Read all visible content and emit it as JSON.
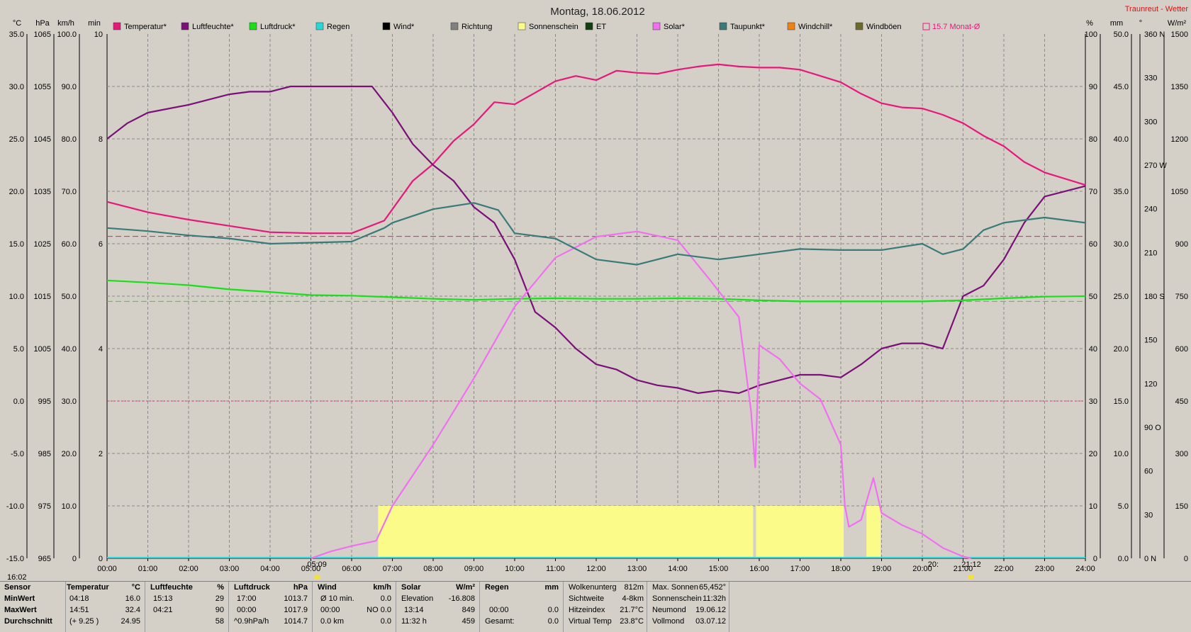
{
  "title": "Montag, 18.06.2012",
  "site": "Traunreut - Wetter",
  "corner_time": "16:02",
  "legend": [
    {
      "label": "Temperatur*",
      "color": "#e8177a"
    },
    {
      "label": "Luftfeuchte*",
      "color": "#7a1078"
    },
    {
      "label": "Luftdruck*",
      "color": "#18e018"
    },
    {
      "label": "Regen",
      "color": "#28d8d8"
    },
    {
      "label": "Wind*",
      "color": "#000000"
    },
    {
      "label": "Richtung",
      "color": "#808080"
    },
    {
      "label": "Sonnenschein",
      "color": "#fbfb8a"
    },
    {
      "label": "ET",
      "color": "#104010"
    },
    {
      "label": "Solar*",
      "color": "#f070f0"
    },
    {
      "label": "Taupunkt*",
      "color": "#3a7a78"
    },
    {
      "label": "Windchill*",
      "color": "#f08010"
    },
    {
      "label": "Windböen",
      "color": "#6a6a2a"
    }
  ],
  "month_avg": "15.7 Monat-Ø",
  "axis_units": {
    "temp": "°C",
    "press": "hPa",
    "wind": "km/h",
    "min": "min",
    "pct": "%",
    "mm": "mm",
    "deg": "°",
    "wm2": "W/m²"
  },
  "axes": {
    "temp": [
      "35.0",
      "30.0",
      "25.0",
      "20.0",
      "15.0",
      "10.0",
      "5.0",
      "0.0",
      "-5.0",
      "-10.0",
      "-15.0"
    ],
    "press": [
      "1065",
      "1055",
      "1045",
      "1035",
      "1025",
      "1015",
      "1005",
      "995",
      "985",
      "975",
      "965"
    ],
    "wind": [
      "100.0",
      "90.0",
      "80.0",
      "70.0",
      "60.0",
      "50.0",
      "40.0",
      "30.0",
      "20.0",
      "10.0",
      "0"
    ],
    "min": [
      "10",
      "",
      "8",
      "",
      "6",
      "",
      "4",
      "",
      "2",
      "",
      "0"
    ],
    "pct": [
      "100",
      "90",
      "80",
      "70",
      "60",
      "50",
      "40",
      "30",
      "20",
      "10",
      "0"
    ],
    "mm": [
      "50.0",
      "45.0",
      "40.0",
      "35.0",
      "30.0",
      "25.0",
      "20.0",
      "15.0",
      "10.0",
      "5.0",
      "0.0"
    ],
    "deg": [
      "360 N",
      "330",
      "300",
      "270 W",
      "240",
      "210",
      "180 S",
      "150",
      "120",
      "90  O",
      "60",
      "30",
      "0  N"
    ],
    "wm2": [
      "1500",
      "1350",
      "1200",
      "1050",
      "900",
      "750",
      "600",
      "450",
      "300",
      "150",
      "0"
    ],
    "x": [
      "00:00",
      "01:00",
      "02:00",
      "03:00",
      "04:00",
      "05:00",
      "06:00",
      "07:00",
      "08:00",
      "09:00",
      "10:00",
      "11:00",
      "12:00",
      "13:00",
      "14:00",
      "15:00",
      "16:00",
      "17:00",
      "18:00",
      "19:00",
      "20:00",
      "21:00",
      "22:00",
      "23:00",
      "24:00"
    ]
  },
  "sun_markers": {
    "sunrise": "05:09",
    "sunset_a": "20:",
    "sunset_b": "21:12"
  },
  "chart_data": {
    "type": "line",
    "title": "Montag, 18.06.2012",
    "x_unit": "hours",
    "series": [
      {
        "name": "Temperatur*",
        "unit": "°C",
        "color": "#e8177a",
        "points": [
          [
            0,
            19
          ],
          [
            1,
            18
          ],
          [
            2,
            17.3
          ],
          [
            3,
            16.7
          ],
          [
            4,
            16.1
          ],
          [
            5,
            16.0
          ],
          [
            6,
            16.0
          ],
          [
            6.8,
            17.2
          ],
          [
            7.5,
            21
          ],
          [
            8,
            22.6
          ],
          [
            8.5,
            24.8
          ],
          [
            9,
            26.4
          ],
          [
            9.5,
            28.5
          ],
          [
            10,
            28.3
          ],
          [
            10.5,
            29.4
          ],
          [
            11,
            30.5
          ],
          [
            11.5,
            31.0
          ],
          [
            12,
            30.6
          ],
          [
            12.5,
            31.5
          ],
          [
            13,
            31.3
          ],
          [
            13.5,
            31.2
          ],
          [
            14,
            31.6
          ],
          [
            14.5,
            31.9
          ],
          [
            15,
            32.1
          ],
          [
            15.5,
            31.9
          ],
          [
            16,
            31.8
          ],
          [
            16.5,
            31.8
          ],
          [
            17,
            31.6
          ],
          [
            17.5,
            31.0
          ],
          [
            18,
            30.4
          ],
          [
            18.5,
            29.3
          ],
          [
            19,
            28.4
          ],
          [
            19.5,
            28.0
          ],
          [
            20,
            27.9
          ],
          [
            20.5,
            27.3
          ],
          [
            21,
            26.5
          ],
          [
            21.5,
            25.3
          ],
          [
            22,
            24.3
          ],
          [
            22.5,
            22.8
          ],
          [
            23,
            21.8
          ],
          [
            24,
            20.6
          ]
        ]
      },
      {
        "name": "Luftfeuchte*",
        "unit": "%",
        "color": "#7a1078",
        "points": [
          [
            0,
            80
          ],
          [
            0.5,
            83
          ],
          [
            1,
            85
          ],
          [
            2,
            86.5
          ],
          [
            3,
            88.5
          ],
          [
            3.5,
            89
          ],
          [
            4,
            89
          ],
          [
            4.5,
            90
          ],
          [
            5,
            90
          ],
          [
            6,
            90
          ],
          [
            6.5,
            90
          ],
          [
            6.8,
            87
          ],
          [
            7,
            85
          ],
          [
            7.5,
            79
          ],
          [
            8,
            75
          ],
          [
            8.5,
            72
          ],
          [
            9,
            67
          ],
          [
            9.5,
            64
          ],
          [
            10,
            57
          ],
          [
            10.5,
            47
          ],
          [
            11,
            44
          ],
          [
            11.5,
            40
          ],
          [
            12,
            37
          ],
          [
            12.5,
            36
          ],
          [
            13,
            34
          ],
          [
            13.5,
            33
          ],
          [
            14,
            32.5
          ],
          [
            14.5,
            31.5
          ],
          [
            15,
            32
          ],
          [
            15.5,
            31.5
          ],
          [
            16,
            33
          ],
          [
            16.5,
            34
          ],
          [
            17,
            35
          ],
          [
            17.5,
            35
          ],
          [
            18,
            34.5
          ],
          [
            18.5,
            37
          ],
          [
            19,
            40
          ],
          [
            19.5,
            41
          ],
          [
            20,
            41
          ],
          [
            20.5,
            40
          ],
          [
            21,
            50
          ],
          [
            21.5,
            52
          ],
          [
            22,
            57
          ],
          [
            22.5,
            64
          ],
          [
            23,
            69
          ],
          [
            24,
            71
          ]
        ]
      },
      {
        "name": "Luftdruck*",
        "unit": "hPa",
        "color": "#18e018",
        "points": [
          [
            0,
            1018.0
          ],
          [
            1,
            1017.6
          ],
          [
            2,
            1017.1
          ],
          [
            3,
            1016.3
          ],
          [
            4,
            1015.8
          ],
          [
            5,
            1015.2
          ],
          [
            6,
            1015.1
          ],
          [
            7,
            1014.8
          ],
          [
            8,
            1014.5
          ],
          [
            9,
            1014.3
          ],
          [
            10,
            1014.5
          ],
          [
            11,
            1014.6
          ],
          [
            12,
            1014.5
          ],
          [
            13,
            1014.5
          ],
          [
            14,
            1014.6
          ],
          [
            15,
            1014.5
          ],
          [
            16,
            1014.2
          ],
          [
            17,
            1014.0
          ],
          [
            18,
            1014.0
          ],
          [
            19,
            1014.0
          ],
          [
            20,
            1014.0
          ],
          [
            21,
            1014.2
          ],
          [
            22,
            1014.6
          ],
          [
            23,
            1014.9
          ],
          [
            24,
            1015.0
          ]
        ]
      },
      {
        "name": "Solar*",
        "unit": "W/m²",
        "color": "#f070f0",
        "points": [
          [
            5,
            0
          ],
          [
            5.5,
            20
          ],
          [
            6,
            35
          ],
          [
            6.6,
            50
          ],
          [
            7,
            150
          ],
          [
            8,
            325
          ],
          [
            9,
            515
          ],
          [
            10,
            720
          ],
          [
            11,
            860
          ],
          [
            12,
            920
          ],
          [
            13,
            935
          ],
          [
            14,
            910
          ],
          [
            14.8,
            795
          ],
          [
            15.5,
            690
          ],
          [
            15.8,
            420
          ],
          [
            15.9,
            260
          ],
          [
            16,
            610
          ],
          [
            16.5,
            570
          ],
          [
            17,
            500
          ],
          [
            17.5,
            455
          ],
          [
            18,
            325
          ],
          [
            18.1,
            150
          ],
          [
            18.2,
            90
          ],
          [
            18.5,
            110
          ],
          [
            18.8,
            230
          ],
          [
            19,
            130
          ],
          [
            19.5,
            95
          ],
          [
            20,
            70
          ],
          [
            20.5,
            30
          ],
          [
            21,
            5
          ],
          [
            21.2,
            0
          ]
        ]
      },
      {
        "name": "Taupunkt*",
        "unit": "°C",
        "color": "#3a7a78",
        "points": [
          [
            0,
            16.5
          ],
          [
            1,
            16.2
          ],
          [
            2,
            15.8
          ],
          [
            3,
            15.5
          ],
          [
            4,
            15.0
          ],
          [
            5,
            15.1
          ],
          [
            6,
            15.2
          ],
          [
            6.8,
            16.5
          ],
          [
            7,
            17
          ],
          [
            8,
            18.3
          ],
          [
            9,
            18.9
          ],
          [
            9.6,
            18.2
          ],
          [
            10,
            16.0
          ],
          [
            11,
            15.5
          ],
          [
            12,
            13.5
          ],
          [
            13,
            13.0
          ],
          [
            14,
            14.0
          ],
          [
            15,
            13.5
          ],
          [
            16,
            14.0
          ],
          [
            17,
            14.5
          ],
          [
            18,
            14.4
          ],
          [
            19,
            14.4
          ],
          [
            20,
            15.0
          ],
          [
            20.5,
            14.0
          ],
          [
            21,
            14.5
          ],
          [
            21.5,
            16.3
          ],
          [
            22,
            17
          ],
          [
            23,
            17.5
          ],
          [
            24,
            17.0
          ]
        ]
      },
      {
        "name": "Sonnenschein",
        "unit": "min",
        "color": "#fbfb8a",
        "segments": [
          [
            6.65,
            15.85
          ],
          [
            15.92,
            18.07
          ],
          [
            18.63,
            18.98
          ]
        ],
        "level": 1
      }
    ],
    "x_range": [
      0,
      24
    ],
    "reference_lines": [
      {
        "name": "15.7 Monat-Ø",
        "unit": "°C",
        "value": 15.7
      }
    ],
    "grid": true
  },
  "footer": {
    "rows": [
      "Sensor",
      "MinWert",
      "MaxWert",
      "Durchschnitt"
    ],
    "temperatur": {
      "header": "Temperatur",
      "unit": "°C",
      "min_time": "04:18",
      "min": "16.0",
      "max_time": "14:51",
      "max": "32.4",
      "avg_note": "(+ 9.25 )",
      "avg": "24.95"
    },
    "luftfeuchte": {
      "header": "Luftfeuchte",
      "unit": "%",
      "min_time": "15:13",
      "min": "29",
      "max_time": "04:21",
      "max": "90",
      "avg": "58"
    },
    "luftdruck": {
      "header": "Luftdruck",
      "unit": "hPa",
      "min_time": "17:00",
      "min": "1013.7",
      "max_time": "00:00",
      "max": "1017.9",
      "avg_note": "^0.9hPa/h",
      "avg": "1014.7"
    },
    "wind": {
      "header": "Wind",
      "unit": "km/h",
      "r1a": "Ø 10 min.",
      "r1b": "0.0",
      "r2a": "00:00",
      "r2b": "NO 0.0",
      "r3a": "0.0 km",
      "r3b": "0.0"
    },
    "solar": {
      "header": "Solar",
      "unit": "W/m²",
      "r1a": "Elevation",
      "r1b": "-16.808",
      "r2a": "13:14",
      "r2b": "849",
      "r3a": "11:32 h",
      "r3b": "459"
    },
    "regen": {
      "header": "Regen",
      "unit": "mm",
      "r2a": "00:00",
      "r2b": "0.0",
      "r3a": "Gesamt:",
      "r3b": "0.0"
    },
    "misc": [
      [
        "Wolkenunterg",
        "812m"
      ],
      [
        "Sichtweite",
        "4-8km"
      ],
      [
        "Hitzeindex",
        "21.7°C"
      ],
      [
        "Virtual Temp",
        "23.8°C"
      ]
    ],
    "astro": [
      [
        "Max. Sonnen",
        "65,452°"
      ],
      [
        "Sonnenschein",
        "11:32h"
      ],
      [
        "Neumond",
        "19.06.12"
      ],
      [
        "Vollmond",
        "03.07.12"
      ]
    ]
  }
}
